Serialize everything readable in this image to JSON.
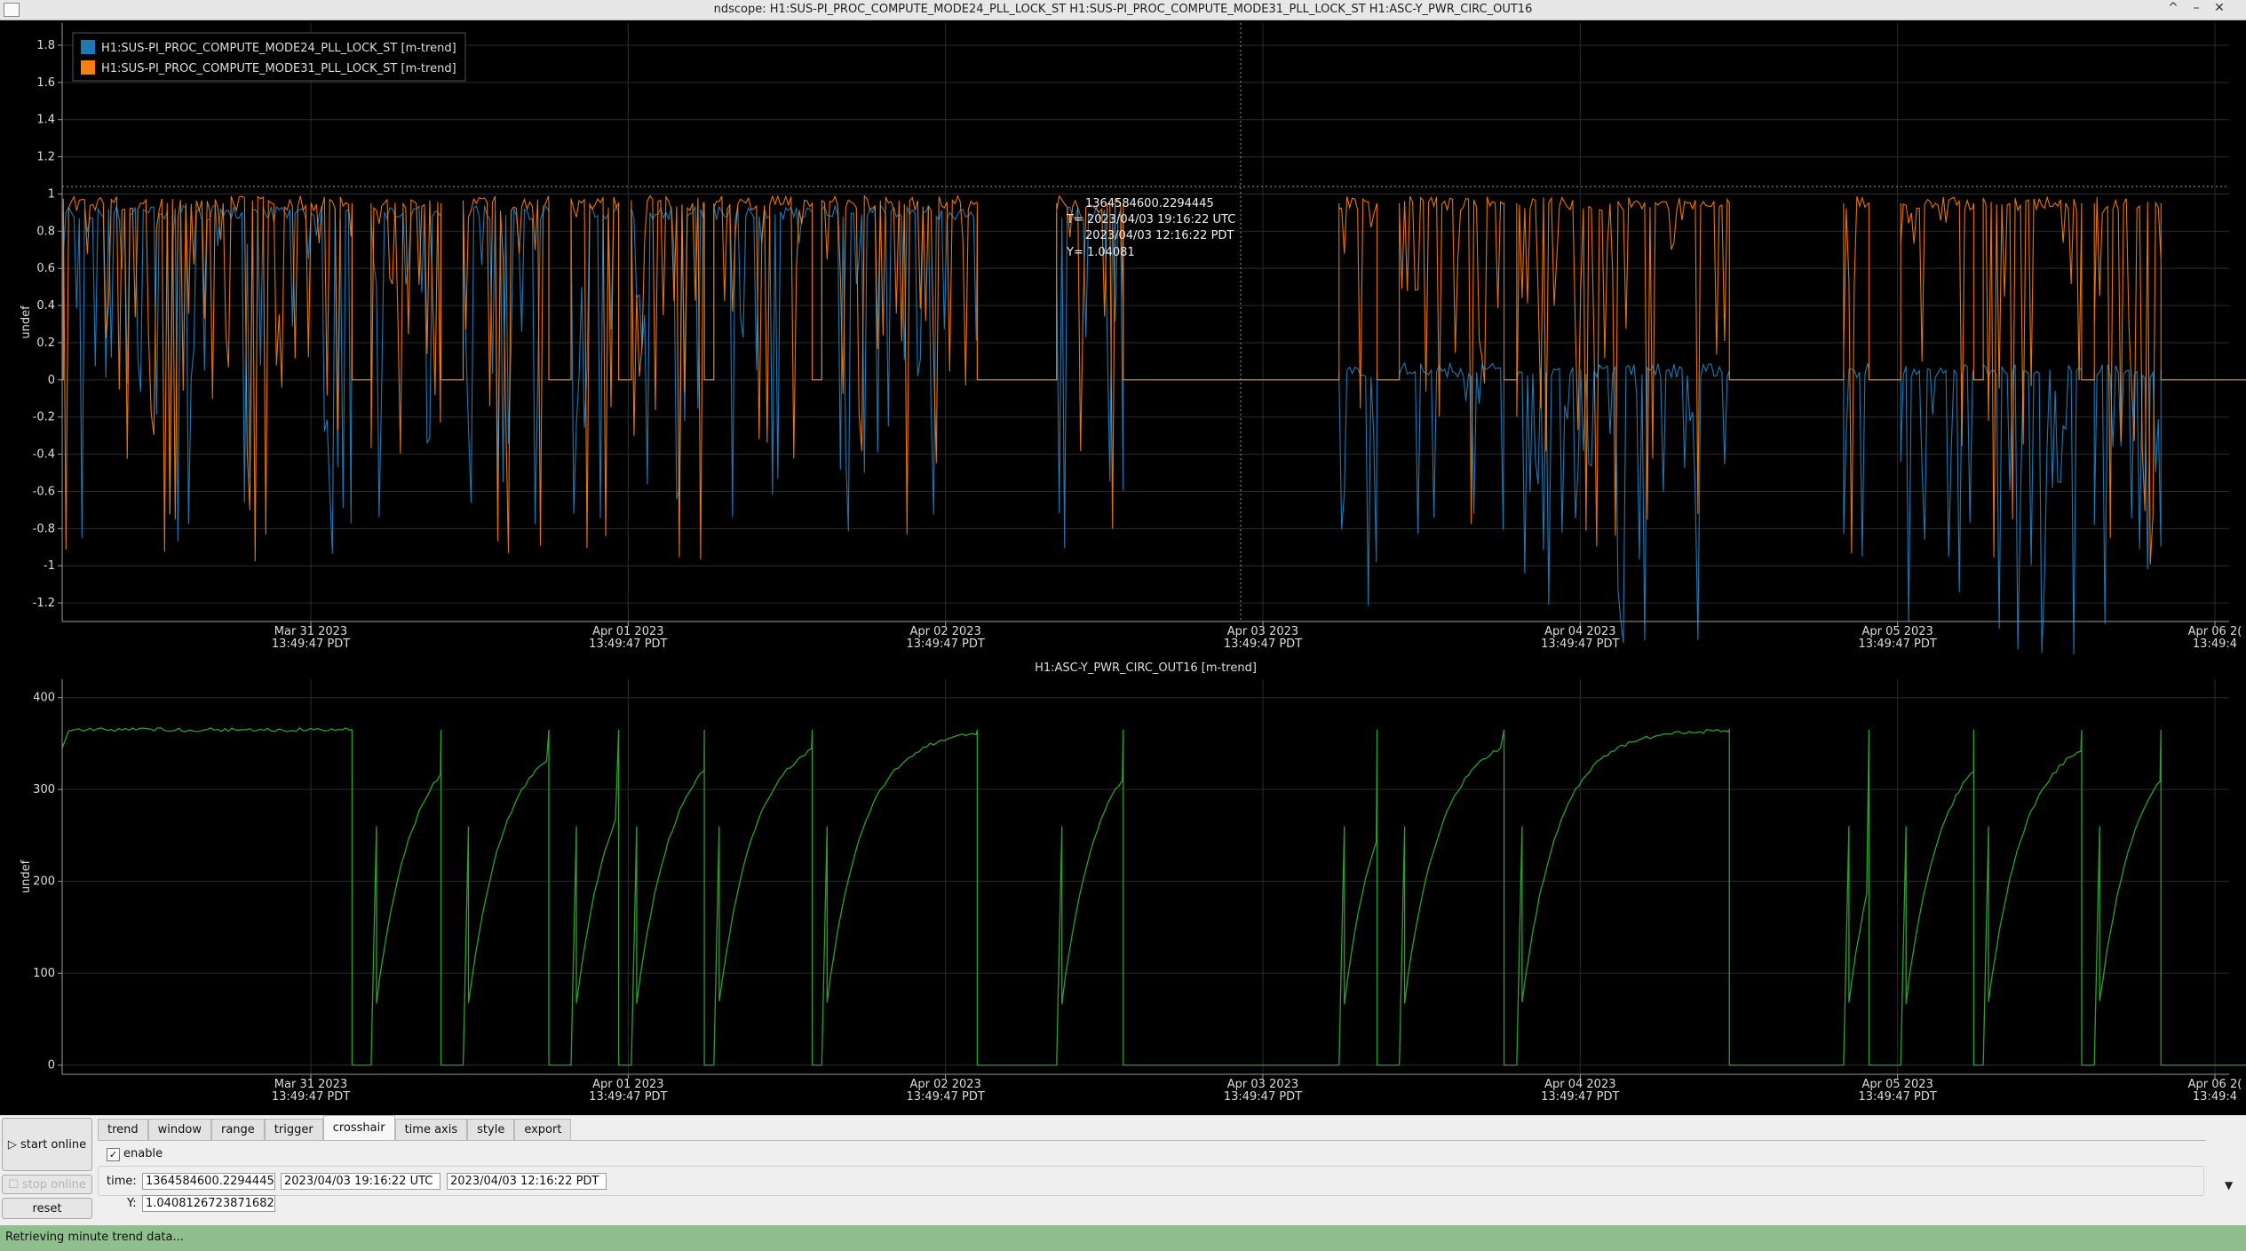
{
  "window": {
    "title": "ndscope: H1:SUS-PI_PROC_COMPUTE_MODE24_PLL_LOCK_ST H1:SUS-PI_PROC_COMPUTE_MODE31_PLL_LOCK_ST H1:ASC-Y_PWR_CIRC_OUT16",
    "controls": [
      "^",
      "–",
      "✕"
    ]
  },
  "colors": {
    "series_blue": "#1f77b4",
    "series_orange": "#ff7f0e",
    "series_green": "#2ca02c",
    "background": "#000000",
    "statusbar": "#8fbf8f"
  },
  "chart_data": [
    {
      "type": "line",
      "title": "",
      "ylabel": "undef",
      "ylim": [
        -1.3,
        1.9
      ],
      "yticks": [
        "1.8",
        "1.6",
        "1.4",
        "1.2",
        "1",
        "0.8",
        "0.6",
        "0.4",
        "0.2",
        "0",
        "-0.2",
        "-0.4",
        "-0.6",
        "-0.8",
        "-1",
        "-1.2"
      ],
      "xticks": [
        {
          "date": "Mar 31 2023",
          "time": "13:49:47 PDT"
        },
        {
          "date": "Apr 01 2023",
          "time": "13:49:47 PDT"
        },
        {
          "date": "Apr 02 2023",
          "time": "13:49:47 PDT"
        },
        {
          "date": "Apr 03 2023",
          "time": "13:49:47 PDT"
        },
        {
          "date": "Apr 04 2023",
          "time": "13:49:47 PDT"
        },
        {
          "date": "Apr 05 2023",
          "time": "13:49:47 PDT"
        },
        {
          "date": "Apr 06 2(",
          "time": "13:49:4"
        }
      ],
      "legend": {
        "placement": "top-left",
        "entries": [
          {
            "name": "H1:SUS-PI_PROC_COMPUTE_MODE24_PLL_LOCK_ST [m-trend]",
            "color": "#1f77b4"
          },
          {
            "name": "H1:SUS-PI_PROC_COMPUTE_MODE31_PLL_LOCK_ST [m-trend]",
            "color": "#ff7f0e"
          }
        ]
      },
      "lock_segments_days": [
        [
          0.0,
          0.91
        ],
        [
          0.97,
          1.19
        ],
        [
          1.26,
          1.53
        ],
        [
          1.6,
          1.75
        ],
        [
          1.79,
          2.02
        ],
        [
          2.05,
          2.36
        ],
        [
          2.39,
          2.88
        ],
        [
          3.13,
          3.34
        ],
        [
          4.02,
          4.14
        ],
        [
          4.21,
          4.54
        ],
        [
          4.58,
          5.25
        ],
        [
          5.61,
          5.69
        ],
        [
          5.79,
          6.02
        ],
        [
          6.05,
          6.36
        ],
        [
          6.4,
          6.61
        ]
      ],
      "series": [
        {
          "name": "H1:SUS-PI_PROC_COMPUTE_MODE24_PLL_LOCK_ST [m-trend]",
          "locked_level": 0.9,
          "locked_level_after_day": 4.0,
          "locked_level_late": 0.05
        },
        {
          "name": "H1:SUS-PI_PROC_COMPUTE_MODE31_PLL_LOCK_ST [m-trend]",
          "locked_level": 0.95
        }
      ],
      "crosshair_label": [
        "1364584600.2294445",
        "T= 2023/04/03 19:16:22 UTC",
        "2023/04/03 12:16:22 PDT",
        "Y= 1.04081"
      ]
    },
    {
      "type": "line",
      "title": "H1:ASC-Y_PWR_CIRC_OUT16 [m-trend]",
      "ylabel": "undef",
      "ylim": [
        -10,
        420
      ],
      "yticks": [
        "400",
        "300",
        "200",
        "100",
        "0"
      ],
      "xticks": [
        {
          "date": "Mar 31 2023",
          "time": "13:49:47 PDT"
        },
        {
          "date": "Apr 01 2023",
          "time": "13:49:47 PDT"
        },
        {
          "date": "Apr 02 2023",
          "time": "13:49:47 PDT"
        },
        {
          "date": "Apr 03 2023",
          "time": "13:49:47 PDT"
        },
        {
          "date": "Apr 04 2023",
          "time": "13:49:47 PDT"
        },
        {
          "date": "Apr 05 2023",
          "time": "13:49:47 PDT"
        },
        {
          "date": "Apr 06 2(",
          "time": "13:49:4"
        }
      ],
      "series": [
        {
          "name": "H1:ASC-Y_PWR_CIRC_OUT16 [m-trend]",
          "lock_power": 365,
          "segments_days": [
            [
              0.0,
              0.91
            ],
            [
              0.97,
              1.19
            ],
            [
              1.26,
              1.53
            ],
            [
              1.6,
              1.75
            ],
            [
              1.79,
              2.02
            ],
            [
              2.05,
              2.36
            ],
            [
              2.39,
              2.88
            ],
            [
              3.13,
              3.34
            ],
            [
              4.02,
              4.14
            ],
            [
              4.21,
              4.54
            ],
            [
              4.58,
              5.25
            ],
            [
              5.61,
              5.69
            ],
            [
              5.79,
              6.02
            ],
            [
              6.05,
              6.36
            ],
            [
              6.4,
              6.61
            ]
          ]
        }
      ]
    }
  ],
  "controls": {
    "start_online": "▷ start online",
    "stop_online": "☐ stop online",
    "reset": "reset",
    "tabs": [
      "trend",
      "window",
      "range",
      "trigger",
      "crosshair",
      "time axis",
      "style",
      "export"
    ],
    "active_tab": "crosshair",
    "enable_checkbox": {
      "label": "enable",
      "checked": true,
      "mark": "✓"
    },
    "time_label": "time:",
    "time_gps": "1364584600.2294445",
    "time_utc": "2023/04/03 19:16:22 UTC",
    "time_pdt": "2023/04/03 12:16:22 PDT",
    "y_label": "Y:",
    "y_value": "1.0408126723871682",
    "expand_arrow": "▼"
  },
  "status": {
    "text": "Retrieving minute trend data..."
  }
}
